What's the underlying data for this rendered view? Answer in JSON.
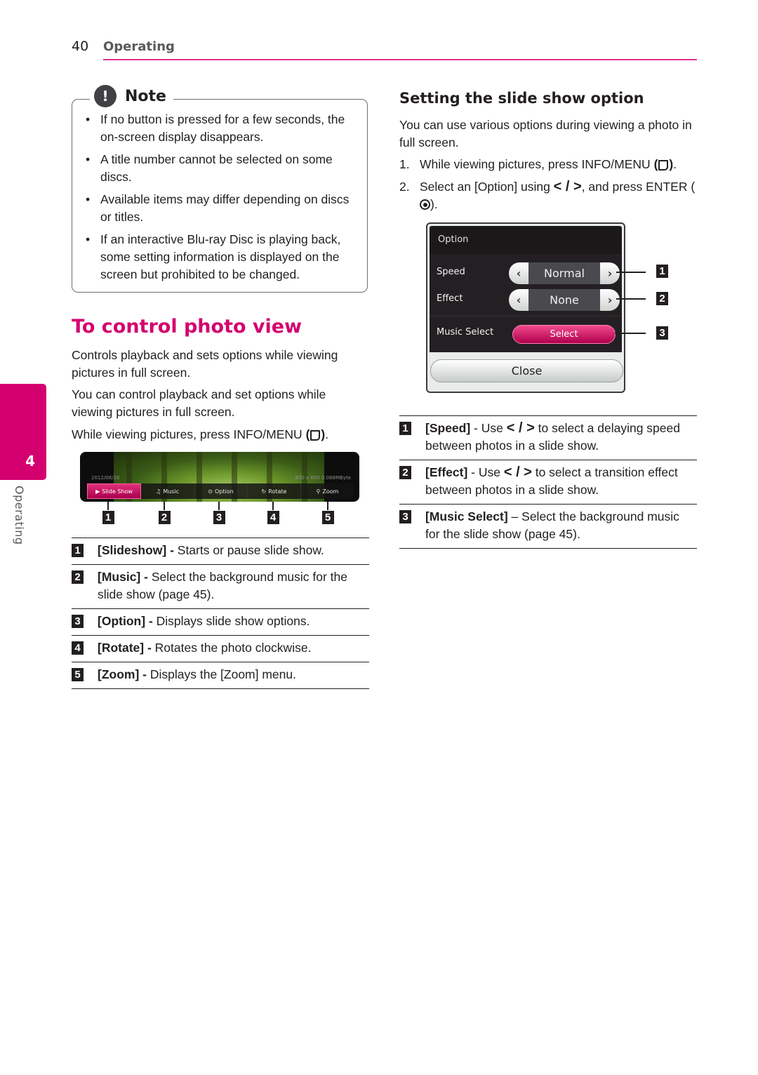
{
  "header": {
    "page_number": "40",
    "section": "Operating"
  },
  "side_tab": {
    "chapter_number": "4",
    "chapter_label": "Operating"
  },
  "note": {
    "title": "Note",
    "icon": "exclamation-icon",
    "items": [
      "If no button is pressed for a few seconds, the on-screen display disappears.",
      "A title number cannot be selected on some discs.",
      "Available items may differ depending on discs or titles.",
      "If an interactive Blu-ray Disc is playing back, some setting information is displayed on the screen but prohibited to be changed."
    ]
  },
  "photo_section": {
    "title": "To control photo view",
    "para1": "Controls playback and sets options while viewing pictures in full screen.",
    "para2": "You can control playback and set options while viewing pictures in full screen.",
    "para3_pre": "While viewing pictures, press INFO/MENU ",
    "para3_post": ".",
    "screen": {
      "date": "2012/08/28",
      "info": "800 x 600    0.088MByte",
      "toolbar": [
        {
          "label": "Slide Show",
          "icon": "play-icon",
          "glyph": "▶",
          "active": true
        },
        {
          "label": "Music",
          "icon": "music-note-icon",
          "glyph": "♫",
          "active": false
        },
        {
          "label": "Option",
          "icon": "option-icon",
          "glyph": "⊙",
          "active": false
        },
        {
          "label": "Rotate",
          "icon": "rotate-icon",
          "glyph": "↻",
          "active": false
        },
        {
          "label": "Zoom",
          "icon": "magnifier-icon",
          "glyph": "🔍",
          "active": false
        }
      ]
    },
    "callouts": [
      "1",
      "2",
      "3",
      "4",
      "5"
    ],
    "definitions": [
      {
        "num": "1",
        "term": "[Slideshow]",
        "sep": " - ",
        "desc": "Starts or pause slide show."
      },
      {
        "num": "2",
        "term": "[Music]",
        "sep": " - ",
        "desc": "Select the background music for the slide show (page 45)."
      },
      {
        "num": "3",
        "term": "[Option]",
        "sep": " - ",
        "desc": "Displays slide show options."
      },
      {
        "num": "4",
        "term": "[Rotate]",
        "sep": " - ",
        "desc": "Rotates the photo clockwise."
      },
      {
        "num": "5",
        "term": "[Zoom]",
        "sep": " - ",
        "desc": "Displays the [Zoom] menu."
      }
    ]
  },
  "slideshow_option": {
    "title": "Setting the slide show option",
    "intro": "You can use various options during viewing a photo in full screen.",
    "steps": [
      {
        "num": "1.",
        "pre": "While viewing pictures, press INFO/MENU ",
        "post": "."
      },
      {
        "num": "2.",
        "pre": "Select an [Option] using ",
        "arrows": "< / >",
        "mid": ", and press ENTER ",
        "post": "."
      }
    ],
    "dialog": {
      "title": "Option",
      "rows": [
        {
          "label": "Speed",
          "value": "Normal"
        },
        {
          "label": "Effect",
          "value": "None"
        }
      ],
      "music_label": "Music Select",
      "select_button": "Select",
      "close_button": "Close",
      "callouts": [
        "1",
        "2",
        "3"
      ]
    },
    "definitions": [
      {
        "num": "1",
        "term": "[Speed]",
        "sep": " - Use ",
        "arrows": "< / >",
        "desc": " to select a delaying speed between photos in a slide show."
      },
      {
        "num": "2",
        "term": "[Effect]",
        "sep": " - Use ",
        "arrows": "< / >",
        "desc": " to select a transition effect between photos in a slide show."
      },
      {
        "num": "3",
        "term": "[Music Select]",
        "sep": " – ",
        "arrows": "",
        "desc": "Select the background music for the slide show (page 45)."
      }
    ]
  },
  "colors": {
    "accent": "#d4006f",
    "rule": "#e2338d",
    "text": "#231f20"
  }
}
